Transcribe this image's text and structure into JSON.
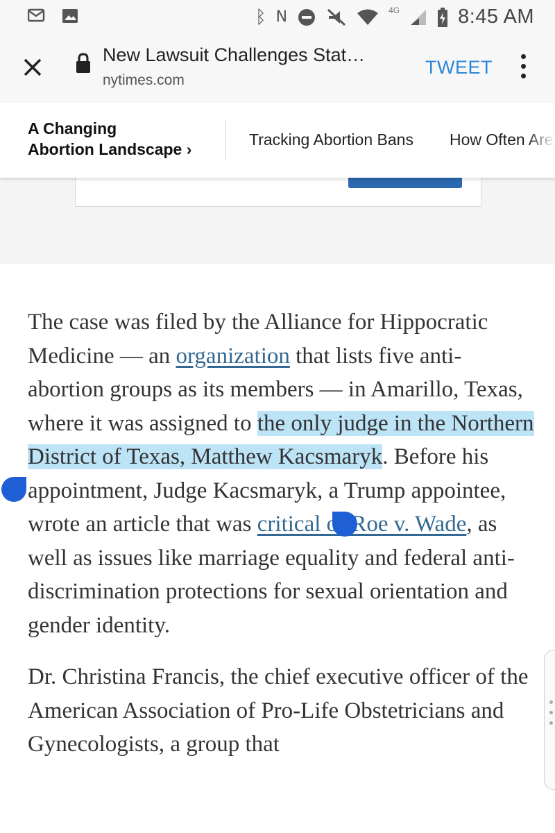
{
  "status_bar": {
    "time": "8:45 AM",
    "network": "4G",
    "left_icons": [
      "message-icon",
      "image-icon"
    ],
    "right_icons": [
      "bluetooth-icon",
      "nfc-icon",
      "do-not-disturb-icon",
      "mute-icon",
      "wifi-icon",
      "signal-icon",
      "battery-charging-icon"
    ]
  },
  "top_bar": {
    "title": "New Lawsuit Challenges Stat…",
    "domain": "nytimes.com",
    "tweet_label": "TWEET"
  },
  "section_nav": {
    "title_line1": "A Changing",
    "title_line2": "Abortion Landscape ›",
    "links": [
      "Tracking Abortion Bans",
      "How Often Are"
    ]
  },
  "article": {
    "p1_part1": "The case was filed by the Alliance for Hippocratic Medicine — an ",
    "p1_link1": "organization",
    "p1_part2": " that lists five anti-abortion groups as its members — in Amarillo, Texas, where it was assigned to ",
    "p1_highlight": "the only judge in the Northern District of Texas, Matthew Kacsmaryk",
    "p1_part3": ". Before his appointment, Judge Kacsmaryk, a Trump appointee, wrote an article that was ",
    "p1_link2": "critical of Roe v. Wade",
    "p1_part4": ", as well as issues like marriage equality and federal anti-discrimination protections for sexual orientation and gender identity.",
    "p2": "Dr. Christina Francis, the chief executive officer of the American Association of Pro-Life Obstetricians and Gynecologists, a group that"
  },
  "colors": {
    "link": "#326891",
    "highlight": "#bde3f7",
    "selection_handle": "#1f5fd6",
    "tweet": "#2b87d7"
  }
}
